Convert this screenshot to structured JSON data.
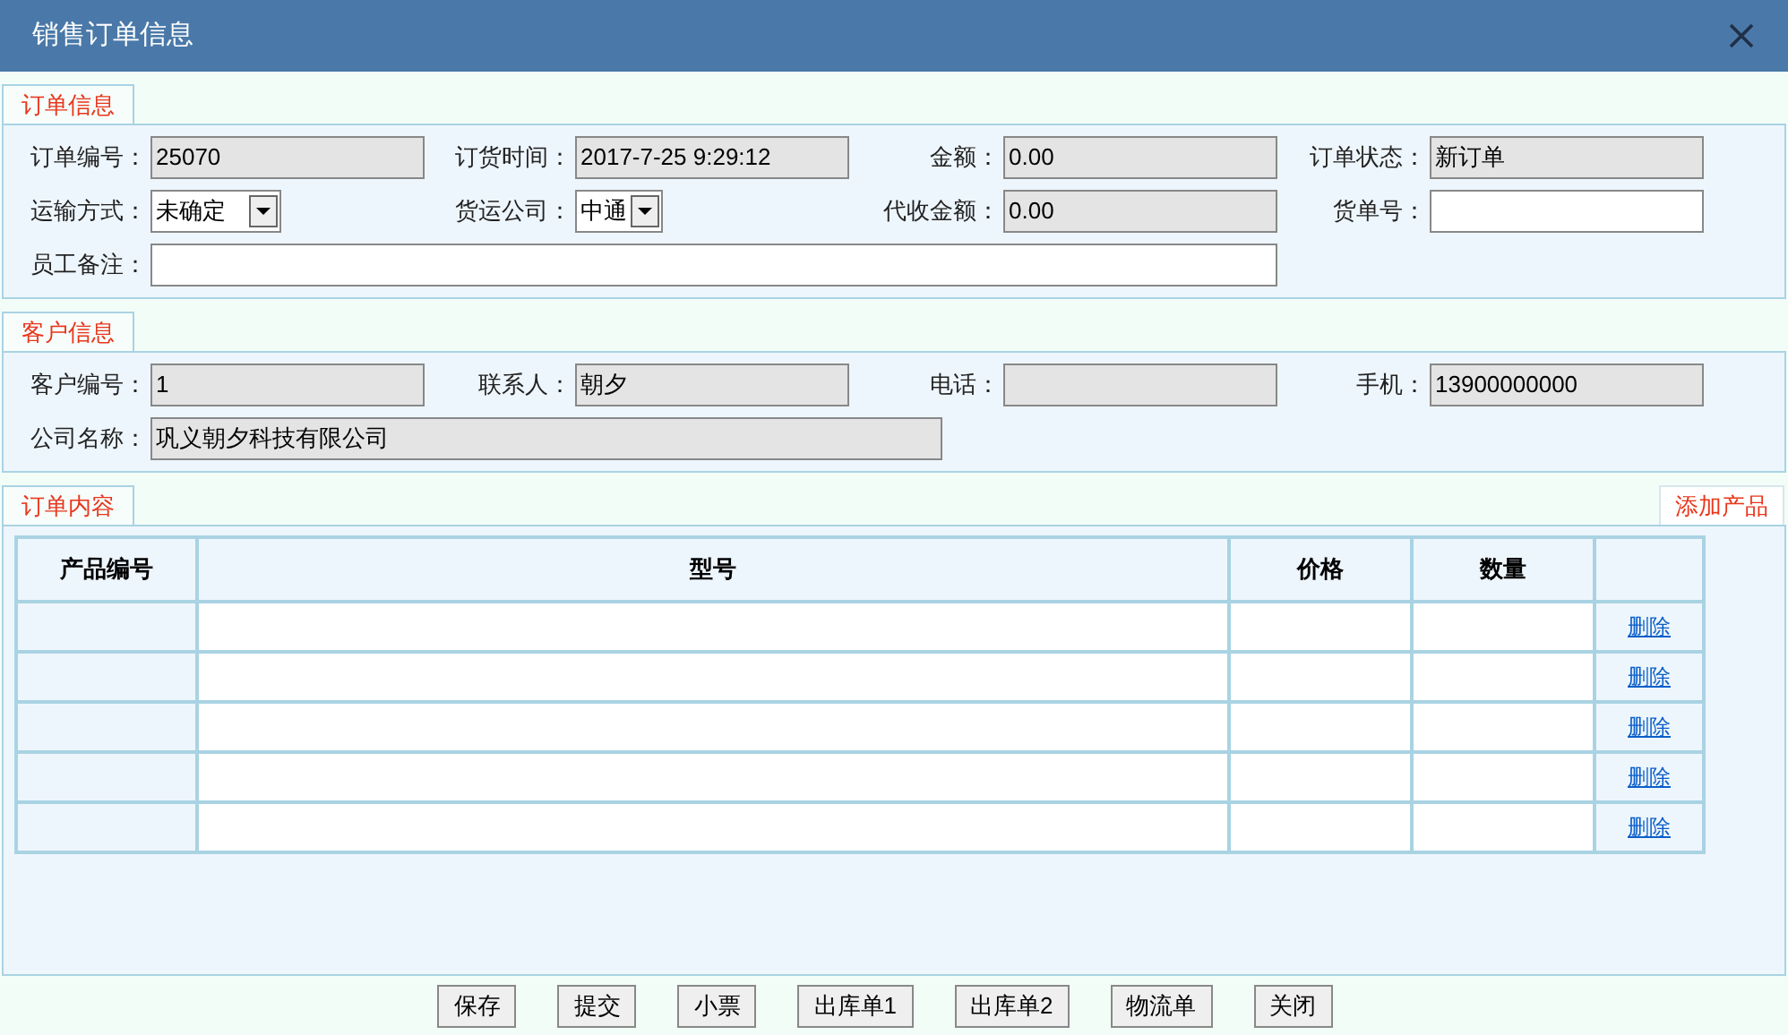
{
  "window": {
    "title": "销售订单信息"
  },
  "sections": [
    {
      "tab": "订单信息",
      "rows": [
        [
          {
            "label": "订单编号：",
            "kind": "readonly",
            "value": "25070"
          },
          {
            "label": "订货时间：",
            "kind": "readonly",
            "value": "2017-7-25 9:29:12"
          },
          {
            "label": "金额：",
            "kind": "readonly",
            "value": "0.00"
          },
          {
            "label": "订单状态：",
            "kind": "readonly",
            "value": "新订单"
          }
        ],
        [
          {
            "label": "运输方式：",
            "kind": "select",
            "value": "未确定"
          },
          {
            "label": "货运公司：",
            "kind": "select-narrow",
            "value": "中通"
          },
          {
            "label": "代收金额：",
            "kind": "readonly",
            "value": "0.00"
          },
          {
            "label": "货单号：",
            "kind": "text"
          }
        ],
        [
          {
            "label": "员工备注：",
            "kind": "text-wide"
          }
        ]
      ]
    },
    {
      "tab": "客户信息",
      "rows": [
        [
          {
            "label": "客户编号：",
            "kind": "readonly",
            "value": "1"
          },
          {
            "label": "联系人：",
            "kind": "readonly",
            "value": "朝夕"
          },
          {
            "label": "电话：",
            "kind": "readonly"
          },
          {
            "label": "手机：",
            "kind": "readonly",
            "value": "13900000000"
          }
        ],
        [
          {
            "label": "公司名称：",
            "kind": "readonly-wide",
            "value": "巩义朝夕科技有限公司"
          }
        ]
      ]
    }
  ],
  "order_content": {
    "tab": "订单内容",
    "add_button": "添加产品",
    "table": {
      "columns": [
        "产品编号",
        "型号",
        "价格",
        "数量"
      ],
      "rows": [
        {
          "action": "删除"
        },
        {
          "action": "删除"
        },
        {
          "action": "删除"
        },
        {
          "action": "删除"
        },
        {
          "action": "删除"
        }
      ]
    }
  },
  "buttons": [
    "保存",
    "提交",
    "小票",
    "出库单1",
    "出库单2",
    "物流单",
    "关闭"
  ]
}
